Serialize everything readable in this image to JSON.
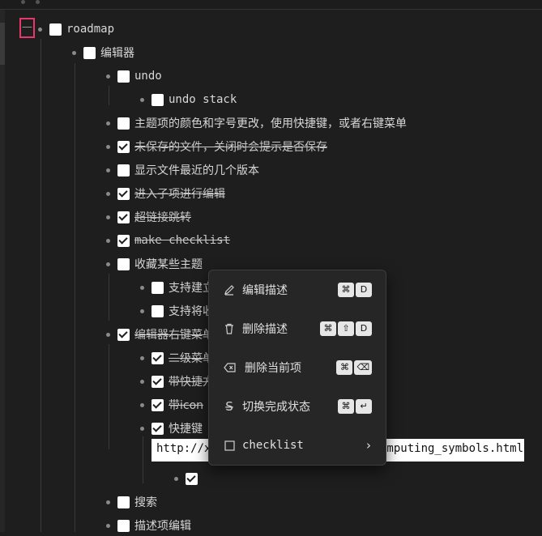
{
  "collapse_symbol": "—",
  "tree": {
    "root": "roadmap",
    "editor_group": "编辑器",
    "undo": "undo",
    "undo_stack": "undo stack",
    "theme_font": "主题项的颜色和字号更改，使用快捷键，或者右键菜单",
    "unsaved": "未保存的文件，关闭时会提示是否保存",
    "recent_versions": "显示文件最近的几个版本",
    "enter_child": "进入子项进行编辑",
    "hyperlink": "超链接跳转",
    "make_checklist": "make checklist",
    "collect_topics": "收藏某些主题",
    "support_create": "支持建立",
    "support_move": "支持将收",
    "context_menu": "编辑器右键菜单",
    "submenu": "二级菜单",
    "shortcut_tip": "带快捷方",
    "with_icon": "带icon",
    "shortcut": "快捷键",
    "search": "搜索",
    "desc_edit": "描述项编辑"
  },
  "editor": {
    "value_left": "http://x",
    "value_right": "omputing_symbols.html"
  },
  "menu": {
    "edit_desc": {
      "label": "编辑描述",
      "keys": [
        "⌘",
        "D"
      ],
      "icon": "pencil-icon"
    },
    "delete_desc": {
      "label": "删除描述",
      "keys": [
        "⌘",
        "⇧",
        "D"
      ],
      "icon": "trash-icon"
    },
    "delete_item": {
      "label": "删除当前项",
      "keys": [
        "⌘",
        "⌫"
      ],
      "icon": "backspace-icon"
    },
    "toggle_done": {
      "label": "切换完成状态",
      "keys": [
        "⌘",
        "↵"
      ],
      "icon": "strikethrough-icon"
    },
    "checklist": {
      "label": "checklist",
      "icon": "checkbox-icon",
      "chevron": "›"
    }
  },
  "colors": {
    "background": "#1e1e1e",
    "menu_bg": "#262626",
    "focus_ring": "#e8386b",
    "checkbox": "#ffffff"
  }
}
